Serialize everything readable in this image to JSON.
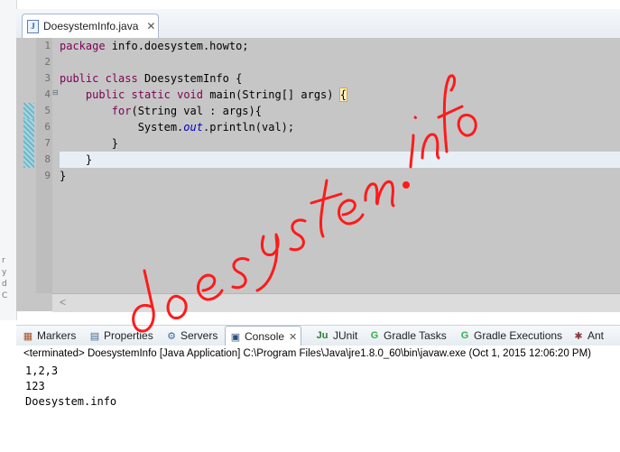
{
  "left_strip": {
    "marks": [
      "r",
      "y",
      "d",
      "C"
    ]
  },
  "editor": {
    "tab": {
      "icon": "java-file-icon",
      "icon_glyph": "J",
      "label": "DoesystemInfo.java",
      "close_glyph": "✕"
    },
    "line_numbers": [
      "1",
      "2",
      "3",
      "4",
      "5",
      "6",
      "7",
      "8",
      "9"
    ],
    "code": {
      "l1": {
        "kw": "package",
        "rest": " info.doesystem.howto;"
      },
      "l2": "",
      "l3": {
        "kw1": "public",
        "sp1": " ",
        "kw2": "class",
        "rest": " DoesystemInfo {"
      },
      "l4": {
        "indent": "    ",
        "kw1": "public",
        "sp1": " ",
        "kw2": "static",
        "sp2": " ",
        "kw3": "void",
        "rest": " main(String[] args) ",
        "brace": "{"
      },
      "l5": {
        "indent": "        ",
        "kw": "for",
        "rest": "(String val : args){"
      },
      "l6": {
        "pre": "            System.",
        "field": "out",
        "rest": ".println(val);"
      },
      "l7": "        }",
      "l8": "    }",
      "l9": "}"
    },
    "scroll_left_glyph": "<"
  },
  "bottom_tabs": [
    {
      "icon": "markers-icon",
      "glyph": "▦",
      "label": "Markers"
    },
    {
      "icon": "properties-icon",
      "glyph": "▤",
      "label": "Properties"
    },
    {
      "icon": "servers-icon",
      "glyph": "⚙",
      "label": "Servers"
    },
    {
      "icon": "console-icon",
      "glyph": "▣",
      "label": "Console",
      "close": "✕"
    },
    {
      "icon": "junit-icon",
      "glyph": "Ju",
      "label": "JUnit"
    },
    {
      "icon": "gradle-tasks-icon",
      "glyph": "G",
      "label": "Gradle Tasks"
    },
    {
      "icon": "gradle-executions-icon",
      "glyph": "G",
      "label": "Gradle Executions"
    },
    {
      "icon": "ant-icon",
      "glyph": "✱",
      "label": "Ant"
    }
  ],
  "console": {
    "status": "<terminated> DoesystemInfo [Java Application] C:\\Program Files\\Java\\jre1.8.0_60\\bin\\javaw.exe (Oct 1, 2015 12:06:20 PM)",
    "output": [
      "1,2,3",
      "123",
      "Doesystem.info"
    ]
  },
  "watermark": {
    "text": "doesystem.info",
    "color": "#ff0000"
  },
  "colors": {
    "keyword": "#7f0055",
    "field": "#0000c0",
    "editor_bg": "#c6c6c6",
    "current_line": "#e8eef6"
  }
}
